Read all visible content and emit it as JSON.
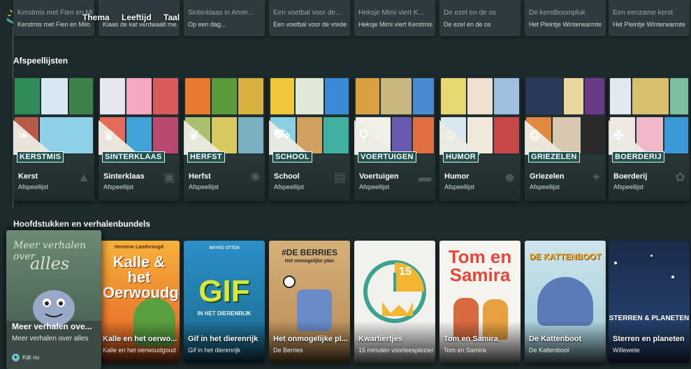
{
  "nav": {
    "items": [
      "Thema",
      "Leeftijd",
      "Taal"
    ]
  },
  "top_row": [
    {
      "title": "Kerstmis met Fien en Milo",
      "subtitle": "Kerstmis met Fien en Milo"
    },
    {
      "title": "",
      "subtitle": "Klaas de kat verdwaalt me..."
    },
    {
      "title": "Sinterklaas in Amer...",
      "subtitle": "Op een dag..."
    },
    {
      "title": "Een voetbal voor de...",
      "subtitle": "Een voetbal voor de vrede"
    },
    {
      "title": "Heksje Mimi viert K...",
      "subtitle": "Heksje Mimi viert Kerstmis"
    },
    {
      "title": "De ezel en de os",
      "subtitle": "De ezel en de os"
    },
    {
      "title": "De kerstboompluk",
      "subtitle": "Het Pleintje Winterwarmte"
    },
    {
      "title": "Een eenzame kerst",
      "subtitle": "Het Pleintje Winterwarmte"
    }
  ],
  "sections": {
    "playlists_title": "Afspeellijsten",
    "chapters_title": "Hoofdstukken en verhalenbundels"
  },
  "playlists": [
    {
      "badge": "KERSTMIS",
      "name": "Kerst",
      "subtitle": "Afspeellijst",
      "icon": "leaf-icon"
    },
    {
      "badge": "SINTERKLAAS",
      "name": "Sinterklaas",
      "subtitle": "Afspeellijst",
      "icon": "mitre-icon"
    },
    {
      "badge": "HERFST",
      "name": "Herfst",
      "subtitle": "Afspeellijst",
      "icon": "leaf-icon"
    },
    {
      "badge": "SCHOOL",
      "name": "School",
      "subtitle": "Afspeellijst",
      "icon": "bus-icon"
    },
    {
      "badge": "VOERTUIGEN",
      "name": "Voertuigen",
      "subtitle": "Afspeellijst",
      "icon": "bike-icon"
    },
    {
      "badge": "HUMOR",
      "name": "Humor",
      "subtitle": "Afspeellijst",
      "icon": "smile-icon"
    },
    {
      "badge": "GRIEZELEN",
      "name": "Griezelen",
      "subtitle": "Afspeellijst",
      "icon": "pumpkin-icon"
    },
    {
      "badge": "BOERDERIJ",
      "name": "Boerderij",
      "subtitle": "Afspeellijst",
      "icon": "duck-icon"
    }
  ],
  "focused_book": {
    "cover_line1": "Meer verhalen over",
    "cover_line2": "alles",
    "name": "Meer verhalen ove...",
    "subtitle": "Meer verhalen over alles",
    "play_label": "Kijk nu"
  },
  "books": [
    {
      "name": "Kalle en het oerwo...",
      "subtitle": "Kalle en het oerwoudgoud",
      "cover_title": "Kalle & het Oerwoudgoud",
      "cover_author": "Hermine Landvreugd"
    },
    {
      "name": "Gif in het dierenrijk",
      "subtitle": "Gif in het dierenrijk",
      "cover_title": "GIF",
      "cover_sub": "IN HET DIERENRIJK",
      "cover_author": "MAYKE OTTEN"
    },
    {
      "name": "Het onmogelijke pl...",
      "subtitle": "De Berries",
      "cover_title": "#DE BERRIES",
      "cover_sub": "Het onmogelijke plan"
    },
    {
      "name": "Kwartiertjes",
      "subtitle": "15 minuten voorleesplezier",
      "cover_number": "15"
    },
    {
      "name": "Tom en Samira",
      "subtitle": "Tom en Samira",
      "cover_title": "Tom en Samira"
    },
    {
      "name": "De Kattenboot",
      "subtitle": "De Kattenboot",
      "cover_title": "DE KATTENBOOT"
    },
    {
      "name": "Sterren en planeten",
      "subtitle": "Willewete",
      "cover_title": "STERREN & PLANETEN"
    }
  ],
  "colors": {
    "background": "#1e2b2d",
    "badge": "#1e5350",
    "accent": "#6ec2c7"
  }
}
